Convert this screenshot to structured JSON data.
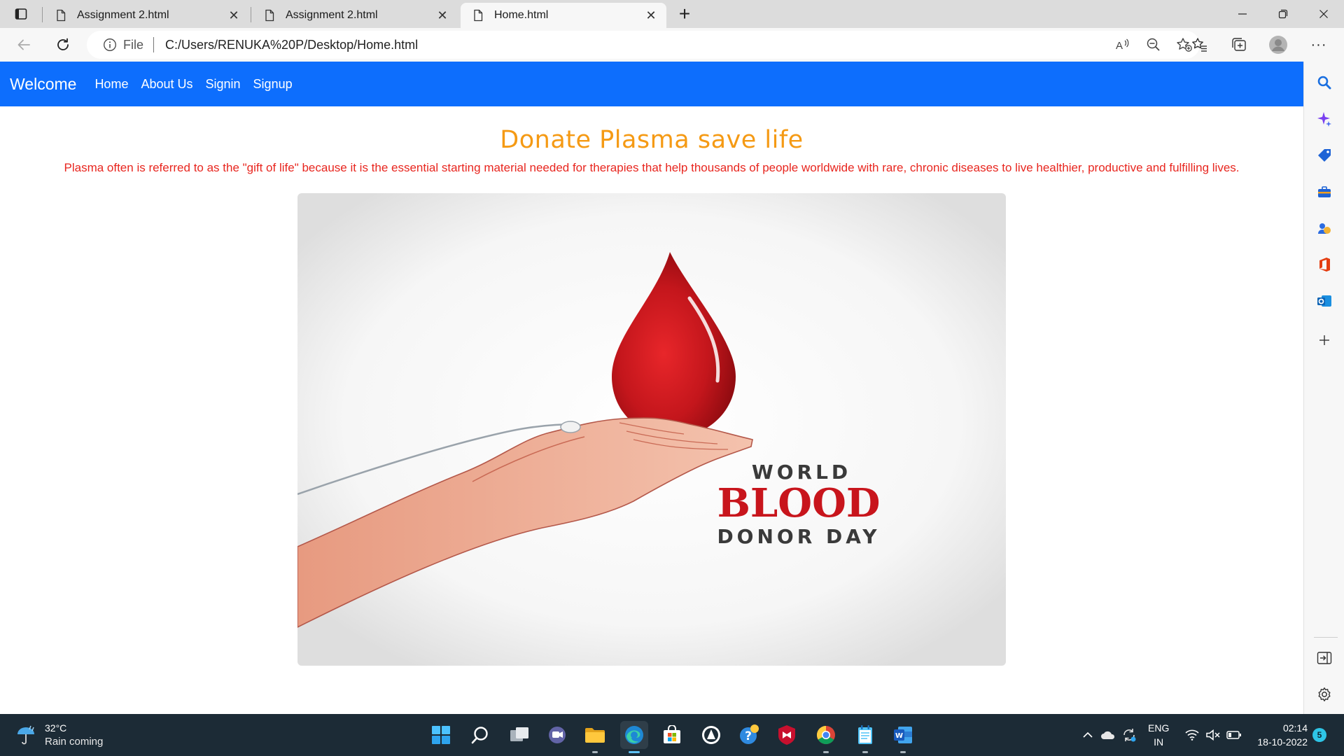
{
  "browser": {
    "tabs": [
      {
        "title": "Assignment 2.html",
        "active": false
      },
      {
        "title": "Assignment 2.html",
        "active": false
      },
      {
        "title": "Home.html",
        "active": true
      }
    ],
    "address": {
      "scheme_label": "File",
      "url": "C:/Users/RENUKA%20P/Desktop/Home.html"
    }
  },
  "page": {
    "navbar": {
      "brand": "Welcome",
      "links": [
        "Home",
        "About Us",
        "Signin",
        "Signup"
      ],
      "background": "#0d6efd"
    },
    "headline": "Donate Plasma save life",
    "headline_color": "#f59a14",
    "lead": "Plasma often is referred to as the \"gift of life\" because it is the essential starting material needed for therapies that help thousands of people worldwide with rare, chronic diseases to live healthier, productive and fulfilling lives.",
    "lead_color": "#e8261f",
    "hero_image": {
      "line1": "WORLD",
      "line2": "BLOOD",
      "line3": "DONOR DAY"
    }
  },
  "taskbar": {
    "weather": {
      "temp": "32°C",
      "desc": "Rain coming"
    },
    "apps": [
      "start-icon",
      "search-icon",
      "task-view-icon",
      "teams-chat-icon",
      "file-explorer-icon",
      "edge-icon",
      "microsoft-store-icon",
      "app-icon",
      "help-icon",
      "mcafee-icon",
      "chrome-icon",
      "notepad-icon",
      "word-icon"
    ],
    "language": {
      "line1": "ENG",
      "line2": "IN"
    },
    "clock": {
      "time": "02:14",
      "date": "18-10-2022"
    },
    "notifications": "5"
  }
}
